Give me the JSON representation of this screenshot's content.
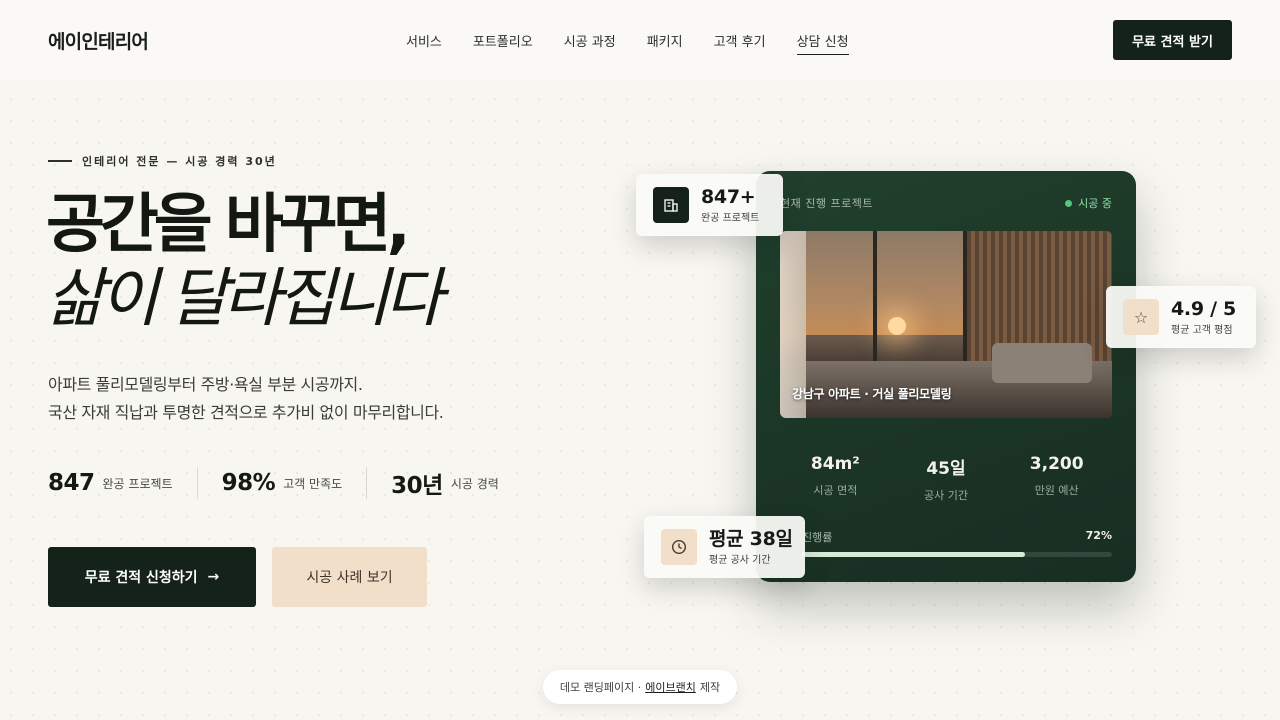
{
  "brand": {
    "name": "에이인테리어"
  },
  "nav": {
    "items": [
      {
        "label": "서비스"
      },
      {
        "label": "포트폴리오"
      },
      {
        "label": "시공 과정"
      },
      {
        "label": "패키지"
      },
      {
        "label": "고객 후기"
      },
      {
        "label": "상담 신청"
      }
    ],
    "active_index": 5,
    "cta_label": "무료 견적 받기"
  },
  "hero": {
    "eyebrow": "인테리어 전문 — 시공 경력 30년",
    "title_line1": "공간을 바꾸면,",
    "title_line2": "삶이 달라집니다",
    "lead_line1": "아파트 풀리모델링부터 주방·욕실 부분 시공까지.",
    "lead_line2": "국산 자재 직납과 투명한 견적으로 추가비 없이 마무리합니다.",
    "stats": [
      {
        "value": "847",
        "label": "완공 프로젝트"
      },
      {
        "value": "98%",
        "label": "고객 만족도"
      },
      {
        "value": "30년",
        "label": "시공 경력"
      }
    ],
    "primary_cta": "무료 견적 신청하기",
    "primary_cta_arrow": "→",
    "secondary_cta": "시공 사례 보기"
  },
  "project_card": {
    "label": "현재 진행 프로젝트",
    "status": "시공 중",
    "photo_caption": "강남구 아파트 · 거실 풀리모델링",
    "stats": [
      {
        "value": "84m²",
        "label": "시공 면적"
      },
      {
        "value": "45일",
        "label": "공사 기간"
      },
      {
        "value": "3,200",
        "label": "만원 예산"
      }
    ],
    "progress_label": "진행률",
    "progress_text": "72%",
    "progress_value": 0.72,
    "colors": {
      "background": "#1b3526",
      "status": "#55c77a"
    }
  },
  "badges": {
    "completed": {
      "value": "847+",
      "label": "완공 프로젝트",
      "icon": "building-icon"
    },
    "rating": {
      "value": "4.9 / 5",
      "label": "평균 고객 평점",
      "icon": "star-icon"
    },
    "duration": {
      "value": "평균 38일",
      "label": "평균 공사 기간",
      "icon": "clock-icon"
    }
  },
  "footer": {
    "prefix": "데모 랜딩페이지 ·",
    "link": "에이브랜치",
    "suffix": "제작"
  },
  "theme": {
    "accent": "#14221a",
    "sand": "#f1dfc9",
    "background": "#f8f6f1"
  }
}
